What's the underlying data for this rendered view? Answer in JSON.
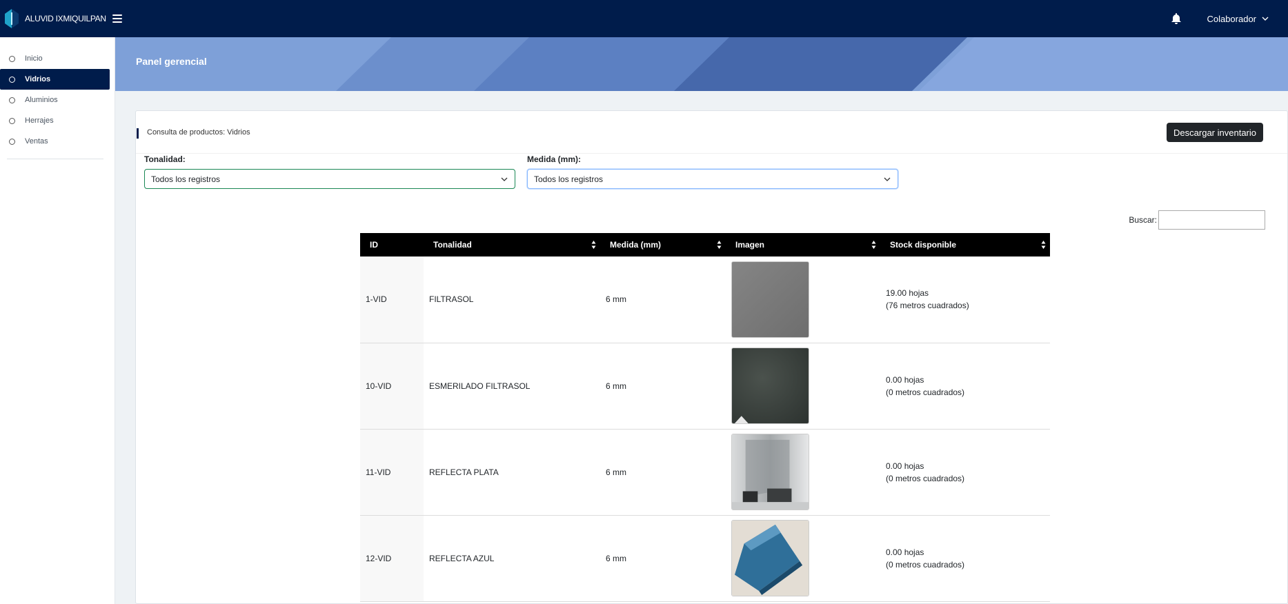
{
  "brand": {
    "name": "ALUVID IXMIQUILPAN"
  },
  "topbar": {
    "user_label": "Colaborador"
  },
  "sidebar": {
    "items": [
      {
        "label": "Inicio",
        "active": false
      },
      {
        "label": "Vidrios",
        "active": true
      },
      {
        "label": "Aluminios",
        "active": false
      },
      {
        "label": "Herrajes",
        "active": false
      },
      {
        "label": "Ventas",
        "active": false
      }
    ]
  },
  "banner": {
    "title": "Panel gerencial"
  },
  "card": {
    "title": "Consulta de productos: Vidrios",
    "download_label": "Descargar inventario"
  },
  "filters": {
    "tonalidad": {
      "label": "Tonalidad:",
      "value": "Todos los registros"
    },
    "medida": {
      "label": "Medida (mm):",
      "value": "Todos los registros"
    }
  },
  "search": {
    "label": "Buscar:",
    "value": ""
  },
  "table": {
    "columns": [
      "ID",
      "Tonalidad",
      "Medida (mm)",
      "Imagen",
      "Stock disponible"
    ],
    "rows": [
      {
        "id": "1-VID",
        "tonalidad": "FILTRASOL",
        "medida": "6 mm",
        "stock_line1": "19.00 hojas",
        "stock_line2": "(76 metros cuadrados)",
        "image": "filtrasol-glass"
      },
      {
        "id": "10-VID",
        "tonalidad": "ESMERILADO FILTRASOL",
        "medida": "6 mm",
        "stock_line1": "0.00 hojas",
        "stock_line2": "(0 metros cuadrados)",
        "image": "esmerilado-glass"
      },
      {
        "id": "11-VID",
        "tonalidad": "REFLECTA PLATA",
        "medida": "6 mm",
        "stock_line1": "0.00 hojas",
        "stock_line2": "(0 metros cuadrados)",
        "image": "reflecta-plata-glass"
      },
      {
        "id": "12-VID",
        "tonalidad": "REFLECTA AZUL",
        "medida": "6 mm",
        "stock_line1": "0.00 hojas",
        "stock_line2": "(0 metros cuadrados)",
        "image": "reflecta-azul-glass"
      }
    ]
  },
  "colors": {
    "navy": "#001c4b",
    "banner": "#7ea0d8",
    "table_header": "#000000"
  }
}
